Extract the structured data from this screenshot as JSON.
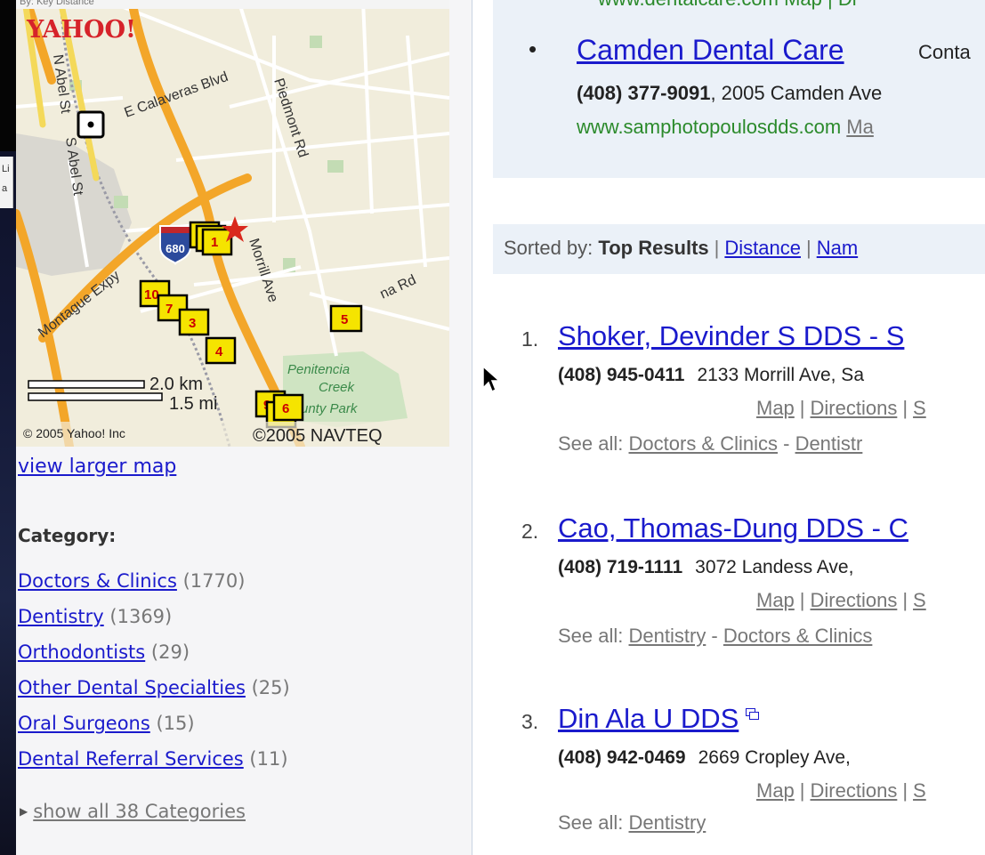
{
  "map": {
    "header_fragment": "By: Key Distance",
    "logo_text": "YAHOO!",
    "streets": {
      "calaveras": "E Calaveras Blvd",
      "piedmont": "Piedmont Rd",
      "abel_n": "N Abel St",
      "abel_s": "S Abel St",
      "montague": "Montague Expy",
      "morrill": "Morrill Ave",
      "road_e": "na Rd",
      "highway": "680"
    },
    "park": {
      "line1": "Penitencia",
      "line2": "Creek",
      "line3": "unty Park"
    },
    "scale": {
      "km": "2.0 km",
      "mi": "1.5 mi"
    },
    "copyright_left": "© 2005 Yahoo! Inc",
    "copyright_right": "©2005 NAVTEQ",
    "markers": [
      "1",
      "10",
      "7",
      "3",
      "4",
      "5",
      "9",
      "6"
    ]
  },
  "left": {
    "view_larger_map": "view larger map",
    "category_heading": "Category:",
    "categories": [
      {
        "label": "Doctors & Clinics",
        "count": "(1770)"
      },
      {
        "label": "Dentistry",
        "count": "(1369)"
      },
      {
        "label": "Orthodontists",
        "count": "(29)"
      },
      {
        "label": "Other Dental Specialties",
        "count": "(25)"
      },
      {
        "label": "Oral Surgeons",
        "count": "(15)"
      },
      {
        "label": "Dental Referral Services",
        "count": "(11)"
      }
    ],
    "show_all": "show all 38 Categories"
  },
  "background_fragment": {
    "line1": "Li",
    "line2": "a"
  },
  "sponsor": {
    "top_fragment": "www.dentalcare.com Map | Di",
    "title": "Camden Dental Care",
    "title_tail": "Conta",
    "phone": "(408) 377-9091",
    "address": ", 2005 Camden Ave",
    "url": "www.samphotopoulosdds.com",
    "map_link": "Ma"
  },
  "sort": {
    "label": "Sorted by:",
    "current": "Top Results",
    "options": [
      "Distance",
      "Nam"
    ]
  },
  "results": [
    {
      "num": "1.",
      "title": "Shoker, Devinder S DDS - S",
      "phone": "(408) 945-0411",
      "address": "2133 Morrill Ave, Sa",
      "links": [
        "Map",
        "Directions",
        "S"
      ],
      "see_all_label": "See all:",
      "see_all": [
        "Doctors & Clinics",
        "Dentistr"
      ],
      "ext_icon": false
    },
    {
      "num": "2.",
      "title": "Cao, Thomas-Dung DDS - C",
      "phone": "(408) 719-1111",
      "address": "3072 Landess Ave,",
      "links": [
        "Map",
        "Directions",
        "S"
      ],
      "see_all_label": "See all:",
      "see_all": [
        "Dentistry",
        "Doctors & Clinics"
      ],
      "ext_icon": false
    },
    {
      "num": "3.",
      "title": "Din Ala U DDS",
      "phone": "(408) 942-0469",
      "address": "2669 Cropley Ave,",
      "links": [
        "Map",
        "Directions",
        "S"
      ],
      "see_all_label": "See all:",
      "see_all": [
        "Dentistry"
      ],
      "ext_icon": true
    }
  ],
  "colors": {
    "link": "#1a1acc",
    "url_green": "#2b8a2b",
    "sponsor_bg": "#ebf1f8",
    "marker_fill": "#f5e400",
    "marker_text": "#cc0000"
  }
}
